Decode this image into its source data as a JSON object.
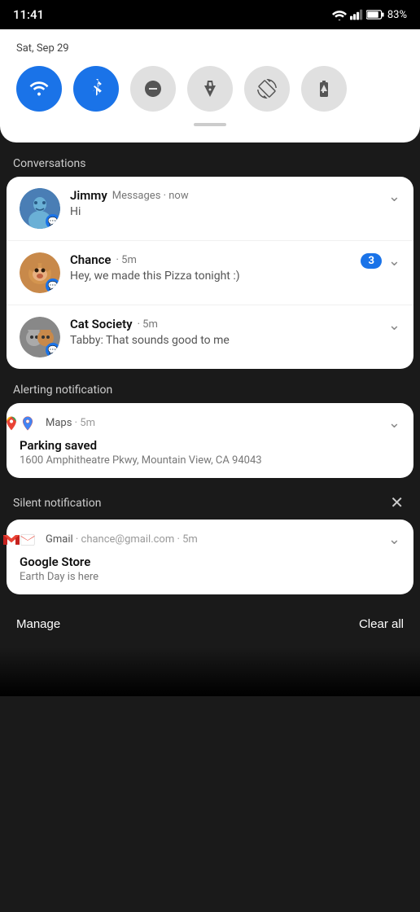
{
  "statusBar": {
    "time": "11:41",
    "battery": "83%"
  },
  "quickSettings": {
    "date": "Sat, Sep 29",
    "toggles": [
      {
        "id": "wifi",
        "active": true,
        "label": "WiFi"
      },
      {
        "id": "bluetooth",
        "active": true,
        "label": "Bluetooth"
      },
      {
        "id": "dnd",
        "active": false,
        "label": "Do Not Disturb"
      },
      {
        "id": "flashlight",
        "active": false,
        "label": "Flashlight"
      },
      {
        "id": "rotate",
        "active": false,
        "label": "Auto-rotate"
      },
      {
        "id": "battery-saver",
        "active": false,
        "label": "Battery Saver"
      }
    ]
  },
  "sections": {
    "conversations": {
      "label": "Conversations",
      "items": [
        {
          "name": "Jimmy",
          "meta": "Messages · now",
          "message": "Hi",
          "badgeCount": null,
          "avatarColor": "#5b9bd5",
          "avatarEmoji": "🧑"
        },
        {
          "name": "Chance",
          "meta": "5m",
          "message": "Hey, we made this Pizza tonight :)",
          "badgeCount": 3,
          "avatarColor": "#c97b3a",
          "avatarEmoji": "🐕"
        },
        {
          "name": "Cat Society",
          "meta": "5m",
          "message": "Tabby: That sounds good to me",
          "badgeCount": null,
          "avatarColor": "#888",
          "avatarEmoji": "🐱"
        }
      ]
    },
    "alertingNotification": {
      "label": "Alerting notification",
      "items": [
        {
          "app": "Maps",
          "meta": "5m",
          "title": "Parking saved",
          "body": "1600 Amphitheatre Pkwy, Mountain View, CA 94043"
        }
      ]
    },
    "silentNotification": {
      "label": "Silent notification",
      "items": [
        {
          "app": "Gmail",
          "meta": "chance@gmail.com · 5m",
          "title": "Google Store",
          "body": "Earth Day is here"
        }
      ]
    }
  },
  "bottomBar": {
    "manageLabel": "Manage",
    "clearAllLabel": "Clear all"
  }
}
